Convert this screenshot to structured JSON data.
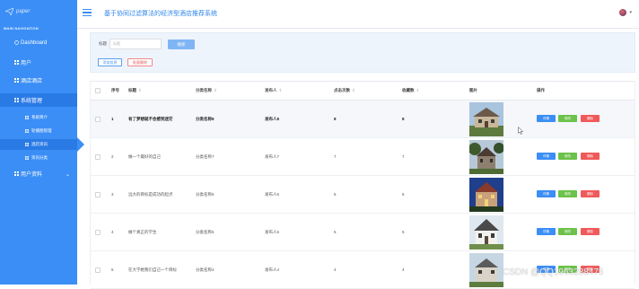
{
  "app": {
    "logo_text": "paper",
    "title": "基于协同过滤算法的经济型酒店推荐系统"
  },
  "sidebar": {
    "caption": "MAIN NAVIGATION",
    "items": [
      {
        "label": "Dashboard",
        "icon": "dashboard-icon"
      },
      {
        "label": "用户",
        "icon": "grid-icon"
      },
      {
        "label": "酒店酒店",
        "icon": "grid-icon"
      },
      {
        "label": "系统管理",
        "icon": "grid-icon"
      },
      {
        "label": "系统简介",
        "icon": "grid-icon"
      },
      {
        "label": "轮播图管理",
        "icon": "grid-icon"
      },
      {
        "label": "酒店资讯",
        "icon": "grid-icon"
      },
      {
        "label": "资讯分类",
        "icon": "grid-icon"
      },
      {
        "label": "用户资料",
        "icon": "grid-icon"
      }
    ]
  },
  "search": {
    "label": "标题",
    "placeholder": "标题",
    "button": "搜索",
    "add": "添加信息",
    "batch_delete": "批量删除"
  },
  "table": {
    "headers": [
      "序号",
      "标题",
      "分类名称",
      "发布人",
      "点击次数",
      "收藏数",
      "图片",
      "操作"
    ],
    "rows": [
      {
        "no": "1",
        "title": "有了梦想就不会感到迷茫",
        "category": "分类名称8",
        "publisher": "发布人8",
        "clicks": "8",
        "favorites": "8"
      },
      {
        "no": "2",
        "title": "做一个最好的自己",
        "category": "分类名称7",
        "publisher": "发布人7",
        "clicks": "7",
        "favorites": "7"
      },
      {
        "no": "3",
        "title": "远大的目标是成功的起点",
        "category": "分类名称6",
        "publisher": "发布人6",
        "clicks": "6",
        "favorites": "6"
      },
      {
        "no": "4",
        "title": "做个真正的学生",
        "category": "分类名称5",
        "publisher": "发布人5",
        "clicks": "5",
        "favorites": "5"
      },
      {
        "no": "5",
        "title": "在大学她我们自己一个目标",
        "category": "分类名称4",
        "publisher": "发布人4",
        "clicks": "4",
        "favorites": "4"
      }
    ],
    "actions": {
      "detail": "详情",
      "edit": "修改",
      "delete": "删除"
    }
  },
  "watermark": "CSDN @QQ1963288475",
  "colors": {
    "accent": "#3b8ef5",
    "success": "#6cc24a",
    "danger": "#f05a5a"
  }
}
